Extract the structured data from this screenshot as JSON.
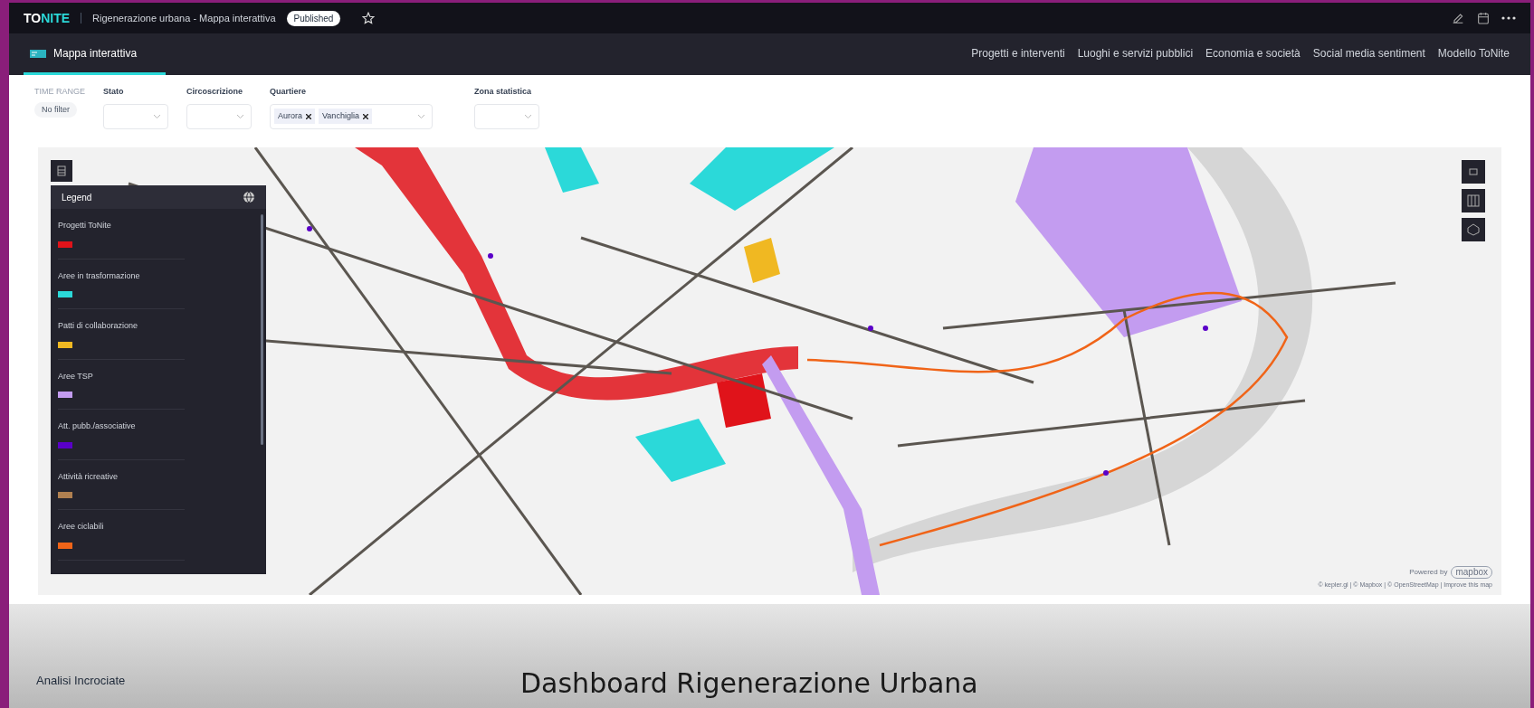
{
  "header": {
    "logo_bold": "TO",
    "logo_accent": "NITE",
    "title": "Rigenerazione urbana - Mappa interattiva",
    "badge": "Published"
  },
  "nav": {
    "tabs": [
      {
        "label": "Mappa interattiva",
        "selected": true
      },
      {
        "label": "Progetti e interventi",
        "selected": false
      },
      {
        "label": "Luoghi e servizi pubblici",
        "selected": false
      },
      {
        "label": "Economia e società",
        "selected": false
      },
      {
        "label": "Social media sentiment",
        "selected": false
      },
      {
        "label": "Modello ToNite",
        "selected": false
      }
    ]
  },
  "filters": {
    "time_range": {
      "label": "TIME RANGE",
      "value": "No filter"
    },
    "selects": [
      {
        "label": "Stato"
      },
      {
        "label": "Circoscrizione"
      },
      {
        "label": "Quartiere",
        "tags": [
          "Aurora",
          "Vanchiglia"
        ]
      },
      {
        "label": "Zona statistica"
      }
    ]
  },
  "map": {
    "legend": {
      "title": "Legend",
      "items": [
        {
          "label": "Progetti ToNite",
          "color": "#e0131a"
        },
        {
          "label": "Aree in trasformazione",
          "color": "#2bd9d9"
        },
        {
          "label": "Patti di collaborazione",
          "color": "#f0b822"
        },
        {
          "label": "Aree TSP",
          "color": "#c39cf0"
        },
        {
          "label": "Att. pubb./associative",
          "color": "#5a00c8"
        },
        {
          "label": "Attività ricreative",
          "color": "#b08050"
        },
        {
          "label": "Aree ciclabili",
          "color": "#f06418"
        }
      ]
    },
    "powered_by": "Powered by",
    "mapbox": "mapbox",
    "attribution": "© kepler.gl | © Mapbox | © OpenStreetMap | Improve this map"
  },
  "section": {
    "title": "Analisi Incrociate"
  },
  "caption": "Dashboard Rigenerazione Urbana"
}
